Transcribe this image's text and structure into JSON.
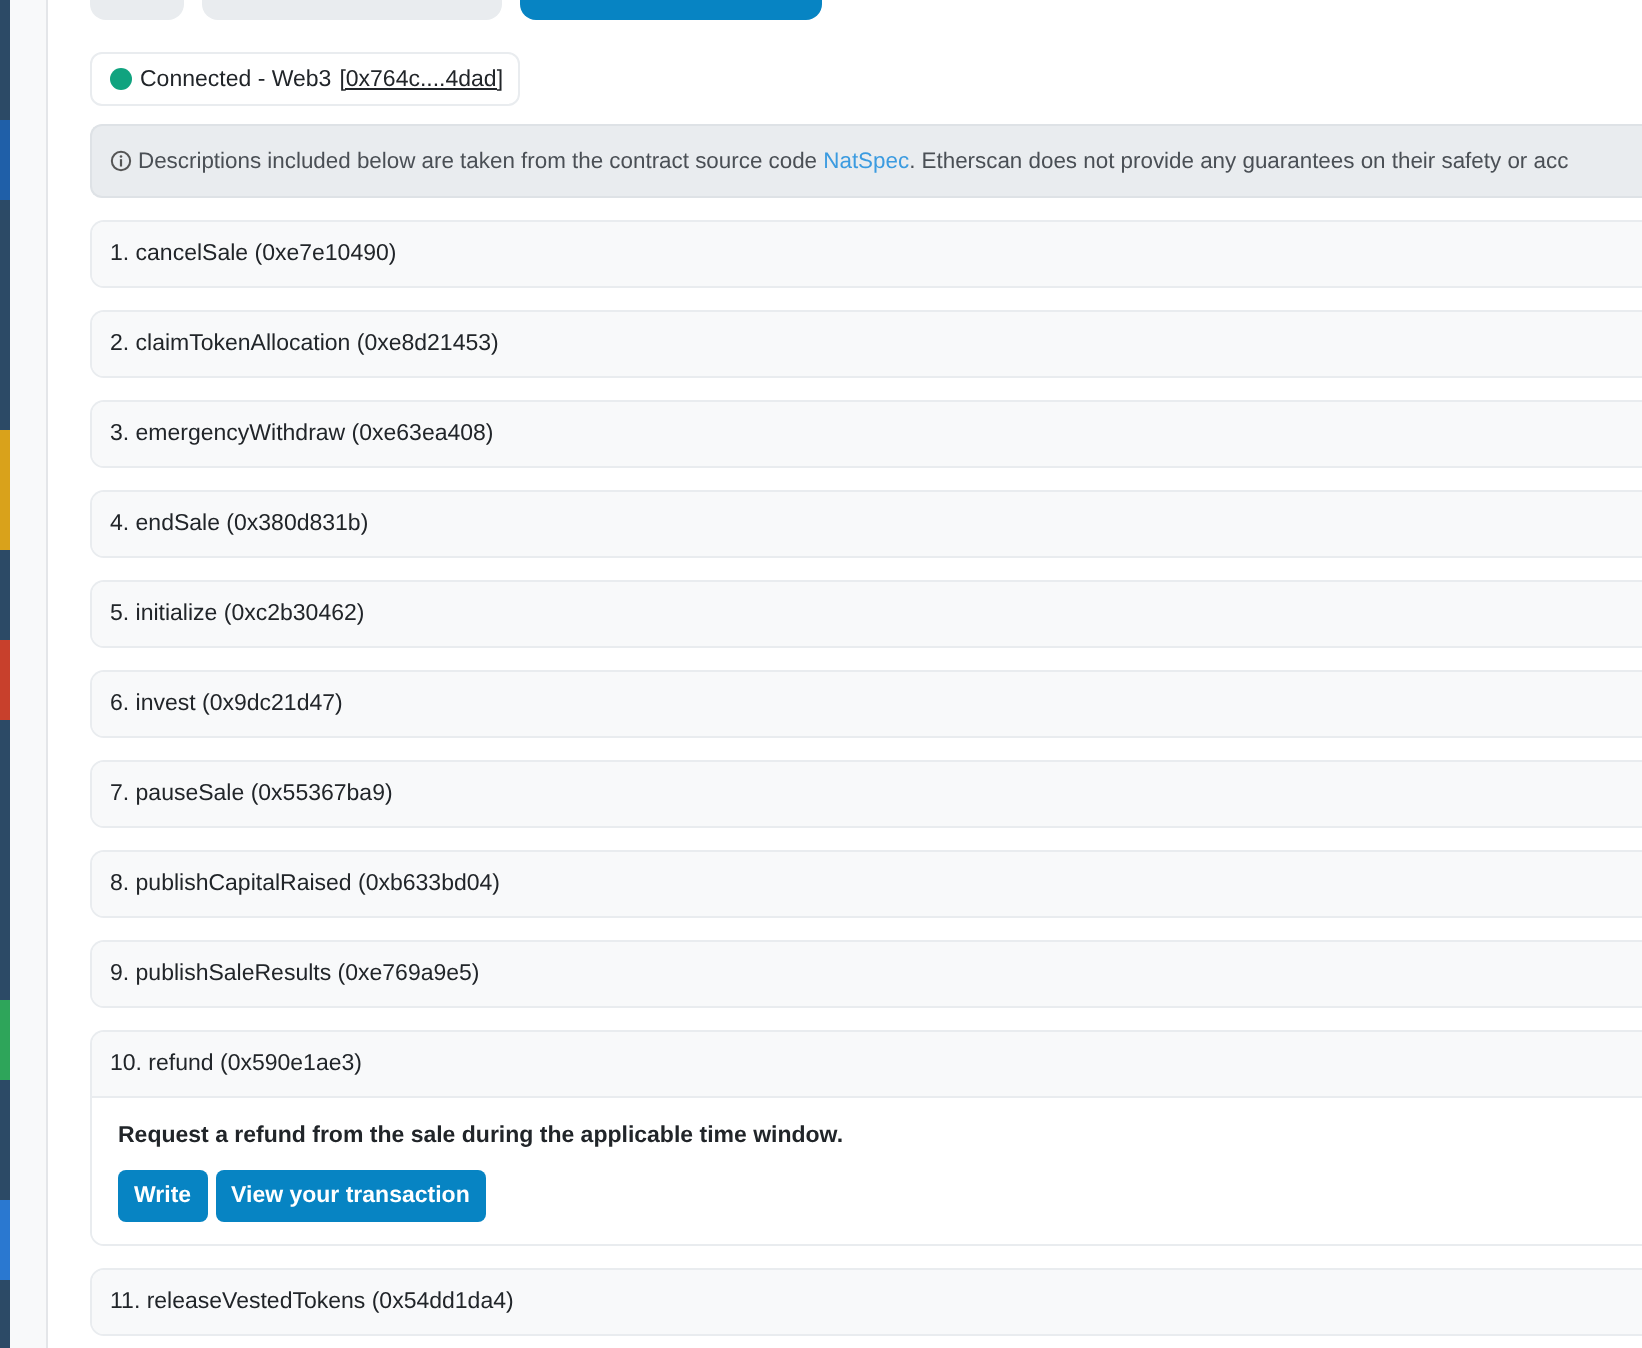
{
  "tabs": [
    {
      "selected": false
    },
    {
      "selected": false
    },
    {
      "selected": true
    }
  ],
  "connection": {
    "status": "Connected - Web3",
    "address": "[0x764c....4dad]",
    "color": "#10a37f"
  },
  "notice": {
    "before": "Descriptions included below are taken from the contract source code ",
    "link": "NatSpec",
    "after": ". Etherscan does not provide any guarantees on their safety or acc"
  },
  "functions": [
    {
      "title": "1. cancelSale (0xe7e10490)",
      "expanded": false
    },
    {
      "title": "2. claimTokenAllocation (0xe8d21453)",
      "expanded": false
    },
    {
      "title": "3. emergencyWithdraw (0xe63ea408)",
      "expanded": false
    },
    {
      "title": "4. endSale (0x380d831b)",
      "expanded": false
    },
    {
      "title": "5. initialize (0xc2b30462)",
      "expanded": false
    },
    {
      "title": "6. invest (0x9dc21d47)",
      "expanded": false
    },
    {
      "title": "7. pauseSale (0x55367ba9)",
      "expanded": false
    },
    {
      "title": "8. publishCapitalRaised (0xb633bd04)",
      "expanded": false
    },
    {
      "title": "9. publishSaleResults (0xe769a9e5)",
      "expanded": false
    },
    {
      "title": "10. refund (0x590e1ae3)",
      "expanded": true,
      "description": "Request a refund from the sale during the applicable time window.",
      "buttons": [
        "Write",
        "View your transaction"
      ]
    },
    {
      "title": "11. releaseVestedTokens (0x54dd1da4)",
      "expanded": false
    }
  ]
}
